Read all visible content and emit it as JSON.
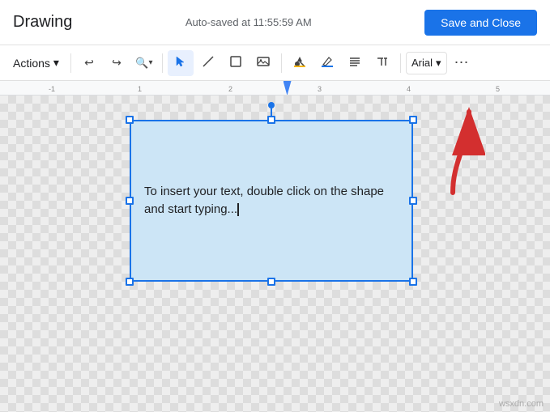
{
  "header": {
    "title": "Drawing",
    "autosave": "Auto-saved at 11:55:59 AM",
    "save_close_label": "Save and Close"
  },
  "toolbar": {
    "actions_label": "Actions",
    "actions_arrow": "▾",
    "undo_icon": "↩",
    "redo_icon": "↪",
    "zoom_icon": "🔍",
    "select_icon": "◻",
    "line_icon": "╱",
    "shape_icon": "⬜",
    "image_icon": "🖼",
    "fill_icon": "◈",
    "line_color_icon": "▬",
    "text_align_icon": "≡",
    "text_format_icon": "⬚",
    "font_label": "Arial",
    "font_arrow": "▾",
    "more_icon": "⋯"
  },
  "ruler": {
    "marks": [
      "-1",
      "1",
      "2",
      "3",
      "4",
      "5"
    ]
  },
  "canvas": {
    "shape_text": "To insert your text, double click on the shape\nand start typing...",
    "shape_text_part1": "To insert your text, double click on the shape",
    "shape_text_part2": "and start typing..."
  },
  "watermark": {
    "text": "wsxdn.com"
  }
}
